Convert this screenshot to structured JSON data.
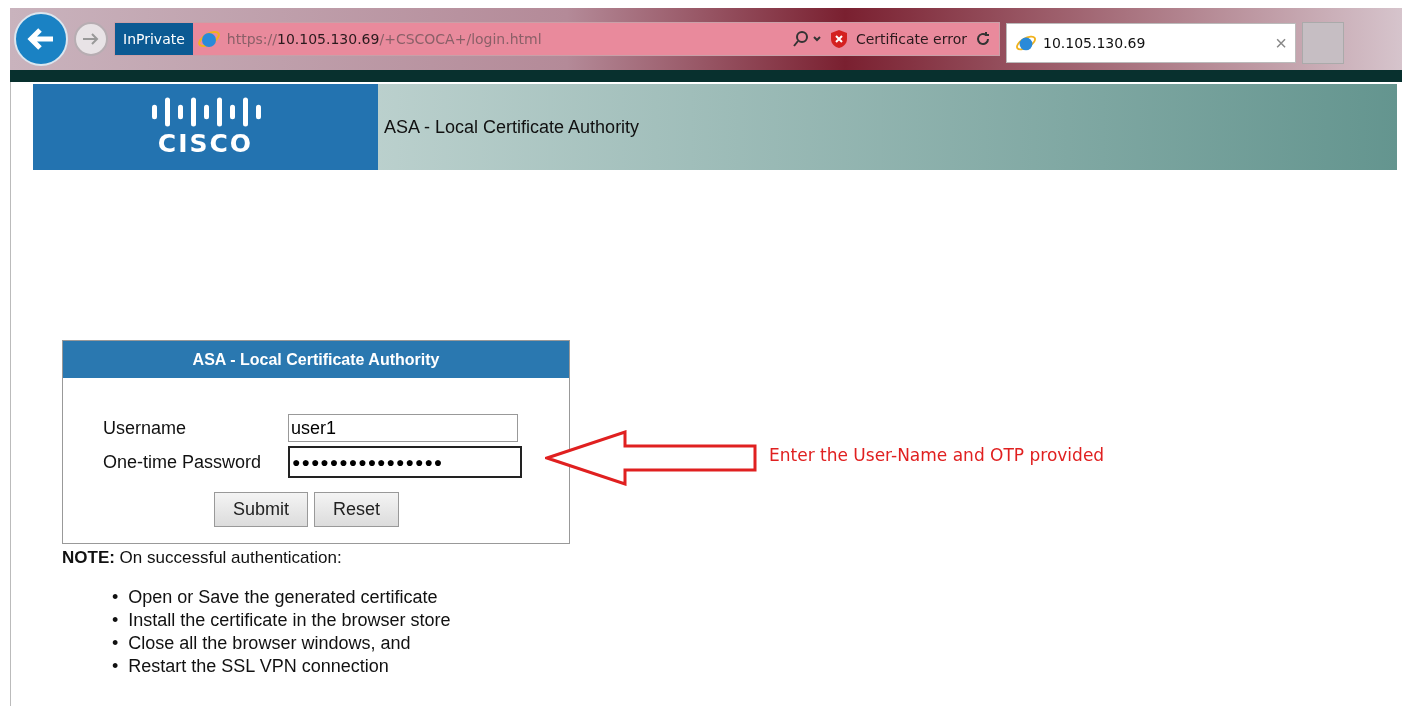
{
  "browser": {
    "private_badge": "InPrivate",
    "url_scheme": "https://",
    "url_host": "10.105.130.69",
    "url_path": "/+CSCOCA+/login.html",
    "security_status": "Certificate error",
    "tabs": [
      {
        "label": "10.105.130.69",
        "selected": true
      }
    ],
    "tab_close": "×"
  },
  "banner": {
    "logo_text": "CISCO",
    "title": "ASA - Local Certificate Authority"
  },
  "login": {
    "title": "ASA - Local Certificate Authority",
    "fields": [
      {
        "label": "Username",
        "value": "user1",
        "focused": false
      },
      {
        "label": "One-time Password",
        "value": "●●●●●●●●●●●●●●●●",
        "focused": true
      }
    ],
    "buttons": [
      "Submit",
      "Reset"
    ]
  },
  "note": {
    "text": "**NOTE:** On successful authentication:",
    "items": [
      {
        "bullet": "•",
        "text": "Open or Save the generated certificate"
      },
      {
        "bullet": "•",
        "text": "Install the certificate in the browser store"
      },
      {
        "bullet": "•",
        "text": "Close all the browser windows, and"
      },
      {
        "bullet": "•",
        "text": "Restart the SSL VPN connection"
      }
    ]
  },
  "callout": {
    "text": "Enter the User-Name and OTP provided"
  }
}
